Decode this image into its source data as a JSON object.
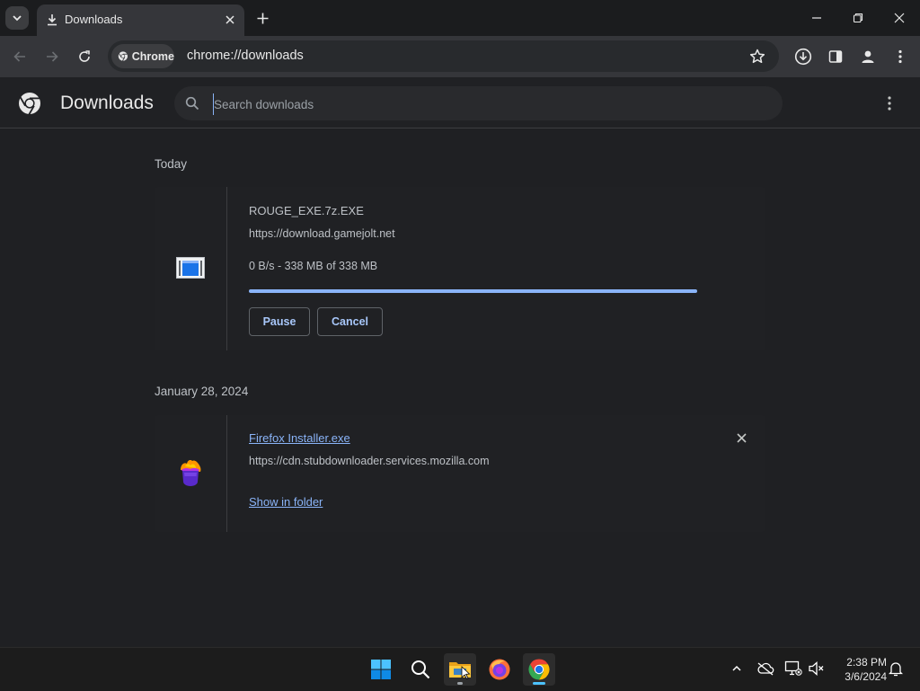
{
  "browser": {
    "tab": {
      "title": "Downloads"
    },
    "address_bar": {
      "chip_label": "Chrome",
      "url": "chrome://downloads"
    }
  },
  "downloads_page": {
    "title": "Downloads",
    "search": {
      "placeholder": "Search downloads",
      "value": ""
    },
    "groups": [
      {
        "date": "Today",
        "items": [
          {
            "filename": "ROUGE_EXE.7z.EXE",
            "url": "https://download.gamejolt.net",
            "status": "0 B/s - 338 MB of 338 MB",
            "progress": 1.0,
            "buttons": {
              "pause": "Pause",
              "cancel": "Cancel"
            }
          }
        ]
      },
      {
        "date": "January 28, 2024",
        "items": [
          {
            "filename": "Firefox Installer.exe",
            "url": "https://cdn.stubdownloader.services.mozilla.com",
            "link": "Show in folder"
          }
        ]
      }
    ]
  },
  "taskbar": {
    "apps": [
      "windows-start",
      "search",
      "file-explorer",
      "firefox",
      "chrome"
    ],
    "clock": {
      "time": "2:38 PM",
      "date": "3/6/2024"
    }
  },
  "colors": {
    "accent": "#8ab4f8",
    "background": "#1f2023",
    "toolbar": "#35363a"
  }
}
